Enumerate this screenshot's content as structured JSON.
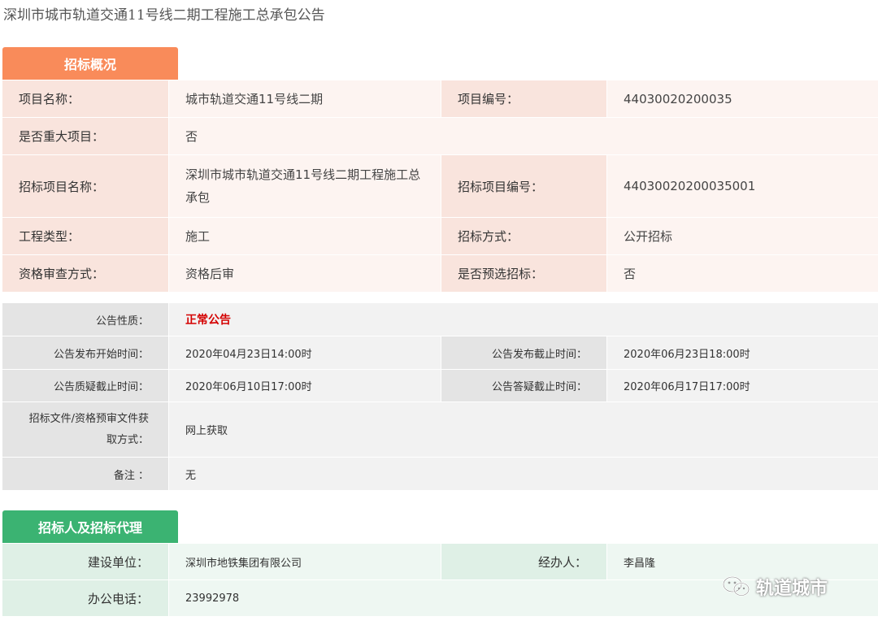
{
  "page": {
    "title": "深圳市城市轨道交通11号线二期工程施工总承包公告"
  },
  "section_overview": {
    "tab_label": "招标概况",
    "rows": [
      [
        "项目名称：",
        "城市轨道交通11号线二期",
        "项目编号：",
        "44030020200035"
      ],
      [
        "是否重大项目：",
        "否"
      ],
      [
        "招标项目名称：",
        "深圳市城市轨道交通11号线二期工程施工总承包",
        "招标项目编号：",
        "44030020200035001"
      ],
      [
        "工程类型：",
        "施工",
        "招标方式：",
        "公开招标"
      ],
      [
        "资格审查方式：",
        "资格后审",
        "是否预选招标：",
        "否"
      ]
    ]
  },
  "section_notice": {
    "rows": [
      [
        "公告性质：",
        "正常公告"
      ],
      [
        "公告发布开始时间：",
        "2020年04月23日14:00时",
        "公告发布截止时间：",
        "2020年06月23日18:00时"
      ],
      [
        "公告质疑截止时间：",
        "2020年06月10日17:00时",
        "公告答疑截止时间：",
        "2020年06月17日17:00时"
      ],
      [
        "招标文件/资格预审文件获取方式：",
        "网上获取"
      ],
      [
        "备注 ：",
        "无"
      ]
    ]
  },
  "section_agent": {
    "tab_label": "招标人及招标代理",
    "rows": [
      [
        "建设单位：",
        "深圳市地铁集团有限公司",
        "经办人：",
        "李昌隆"
      ],
      [
        "办公电话：",
        "23992978"
      ]
    ]
  },
  "watermark": {
    "text": "轨道城市",
    "icon": "wechat-icon"
  },
  "colors": {
    "overview_tab": "#f98b5a",
    "agent_tab": "#3bb372",
    "notice_highlight": "#d40000"
  }
}
